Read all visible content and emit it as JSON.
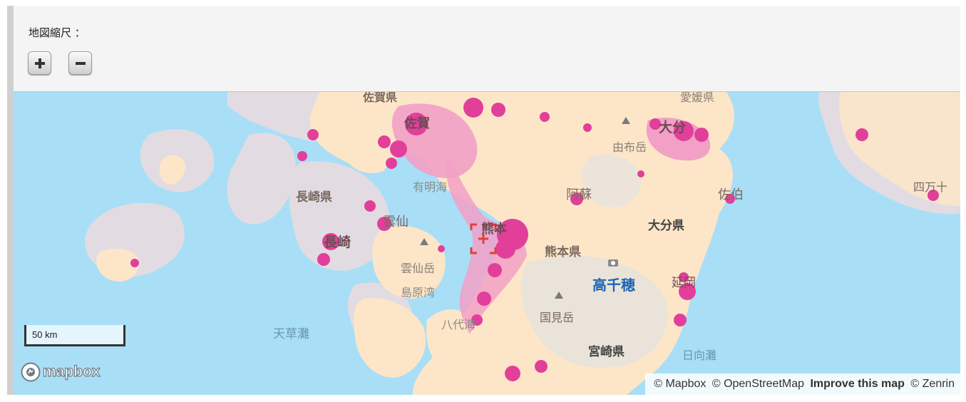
{
  "controls": {
    "scale_label": "地図縮尺 ：",
    "zoom_in": "+",
    "zoom_out": "−"
  },
  "map": {
    "labels": {
      "saga_pref": "佐賀県",
      "saga": "佐賀",
      "oita": "大分",
      "yufuin": "由布岳",
      "nagasaki_pref": "長崎県",
      "ariake": "有明海",
      "aso": "阿蘇",
      "saiki": "佐伯",
      "shimanto": "四万十",
      "unzen": "雲仙",
      "nagasaki": "長崎",
      "kumamoto": "熊本",
      "oita_pref": "大分県",
      "kumamoto_pref": "熊本県",
      "unzendake": "雲仙岳",
      "takachiho": "高千穂",
      "nobeoka": "延岡",
      "shimabara": "島原湾",
      "yatsushiro": "八代海",
      "kunimidake": "国見岳",
      "amakusa": "天草灘",
      "miyazaki_pref": "宮崎県",
      "hyuganada": "日向灘",
      "ehime_pref": "愛媛県"
    },
    "scale_text": "50 km",
    "logo_text": "mapbox",
    "attribution": {
      "mapbox": "© Mapbox",
      "osm": "© OpenStreetMap",
      "improve": "Improve this map",
      "zenrin": "© Zenrin"
    },
    "colors": {
      "sea": "#a9def7",
      "land": "#fde6c8",
      "other_land": "#e2dce2",
      "urban": "#f2a0c6",
      "city": "#e23f9b",
      "marker": "#e0413a",
      "blue_label": "#1e63b4"
    }
  }
}
